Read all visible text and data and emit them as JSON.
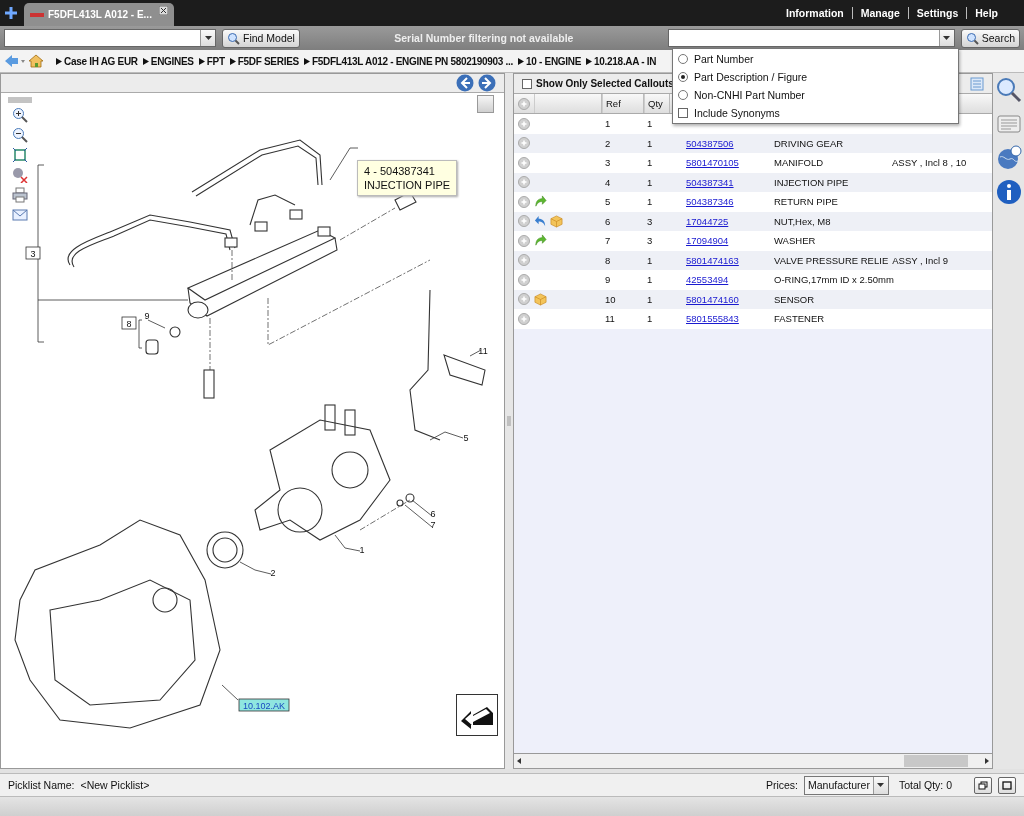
{
  "top_bar": {
    "tab": {
      "title": "F5DFL413L A012 - E...",
      "selected": true
    },
    "menu": [
      "Information",
      "Manage",
      "Settings",
      "Help"
    ]
  },
  "toolbar": {
    "find_button": "Find Model",
    "serial_notice": "Serial Number filtering not available",
    "search_button": "Search"
  },
  "search_options": [
    {
      "kind": "radio",
      "label": "Part Number",
      "selected": false
    },
    {
      "kind": "radio",
      "label": "Part Description / Figure",
      "selected": true
    },
    {
      "kind": "radio",
      "label": "Non-CNHI Part Number",
      "selected": false
    },
    {
      "kind": "checkbox",
      "label": "Include Synonyms",
      "checked": false
    }
  ],
  "breadcrumb": [
    "Case IH AG EUR",
    "ENGINES",
    "FPT",
    "F5DF SERIES",
    "F5DFL413L A012 - ENGINE PN 5802190903 ...",
    "10 - ENGINE",
    "10.218.AA - IN"
  ],
  "diagram": {
    "tooltip": {
      "line_1": "4 -  504387341",
      "line_2": "INJECTION PIPE"
    },
    "callouts": [
      {
        "text": "3",
        "kind": "boxed"
      },
      {
        "text": "8",
        "kind": "boxed"
      },
      {
        "text": "9",
        "kind": "plain"
      },
      {
        "text": "11",
        "kind": "plain"
      },
      {
        "text": "5",
        "kind": "plain"
      },
      {
        "text": "6",
        "kind": "plain"
      },
      {
        "text": "7",
        "kind": "plain"
      },
      {
        "text": "1",
        "kind": "plain"
      },
      {
        "text": "2",
        "kind": "plain"
      },
      {
        "text": "10.102.AK",
        "kind": "link"
      }
    ]
  },
  "parts_panel": {
    "show_selected": {
      "label": "Show Only Selected Callouts",
      "checked": false
    },
    "columns": [
      "Ref",
      "Qty"
    ],
    "rows": [
      {
        "forward_arrow": false,
        "back_arrow": false,
        "package": false,
        "ref": "1",
        "qty": "1"
      },
      {
        "forward_arrow": false,
        "back_arrow": false,
        "package": false,
        "ref": "2",
        "qty": "1",
        "part": "504387506",
        "description": "DRIVING GEAR"
      },
      {
        "forward_arrow": false,
        "back_arrow": false,
        "package": false,
        "ref": "3",
        "qty": "1",
        "part": "5801470105",
        "description": "MANIFOLD",
        "remarks": "ASSY , Incl 8 , 10"
      },
      {
        "forward_arrow": false,
        "back_arrow": false,
        "package": false,
        "ref": "4",
        "qty": "1",
        "part": "504387341",
        "description": "INJECTION PIPE"
      },
      {
        "forward_arrow": true,
        "back_arrow": false,
        "package": false,
        "ref": "5",
        "qty": "1",
        "part": "504387346",
        "description": "RETURN PIPE"
      },
      {
        "forward_arrow": false,
        "back_arrow": true,
        "package": true,
        "ref": "6",
        "qty": "3",
        "part": "17044725",
        "description": "NUT,Hex, M8"
      },
      {
        "forward_arrow": true,
        "back_arrow": false,
        "package": false,
        "ref": "7",
        "qty": "3",
        "part": "17094904",
        "description": "WASHER"
      },
      {
        "forward_arrow": false,
        "back_arrow": false,
        "package": false,
        "ref": "8",
        "qty": "1",
        "part": "5801474163",
        "description": "VALVE PRESSURE RELIE",
        "remarks": "ASSY , Incl 9"
      },
      {
        "forward_arrow": false,
        "back_arrow": false,
        "package": false,
        "ref": "9",
        "qty": "1",
        "part": "42553494",
        "description": "O-RING,17mm ID x 2.50mm"
      },
      {
        "forward_arrow": false,
        "back_arrow": false,
        "package": true,
        "ref": "10",
        "qty": "1",
        "part": "5801474160",
        "description": "SENSOR"
      },
      {
        "forward_arrow": false,
        "back_arrow": false,
        "package": false,
        "ref": "11",
        "qty": "1",
        "part": "5801555843",
        "description": "FASTENER"
      }
    ]
  },
  "status_bar": {
    "picklist_label": "Picklist Name:",
    "picklist_value": "<New Picklist>",
    "prices_label": "Prices:",
    "prices_value": "Manufacturer",
    "total_qty": "Total Qty: 0"
  }
}
